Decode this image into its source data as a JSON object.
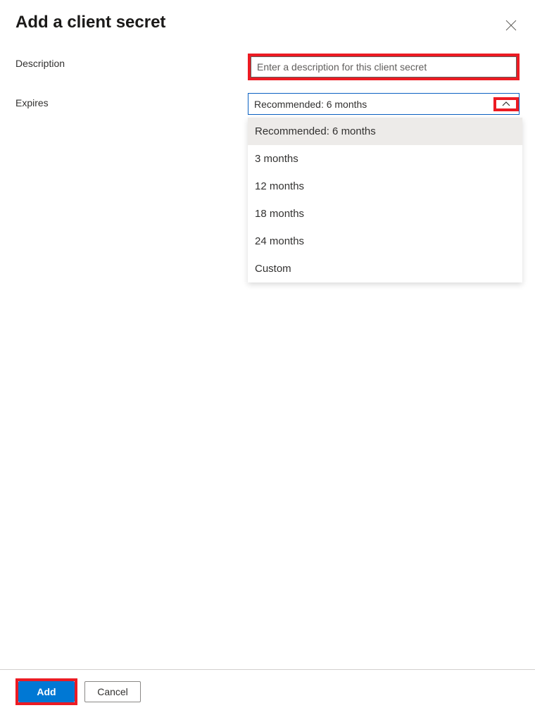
{
  "header": {
    "title": "Add a client secret"
  },
  "form": {
    "description": {
      "label": "Description",
      "placeholder": "Enter a description for this client secret",
      "value": ""
    },
    "expires": {
      "label": "Expires",
      "selected": "Recommended: 6 months",
      "options": [
        "Recommended: 6 months",
        "3 months",
        "12 months",
        "18 months",
        "24 months",
        "Custom"
      ]
    }
  },
  "footer": {
    "add_label": "Add",
    "cancel_label": "Cancel"
  }
}
